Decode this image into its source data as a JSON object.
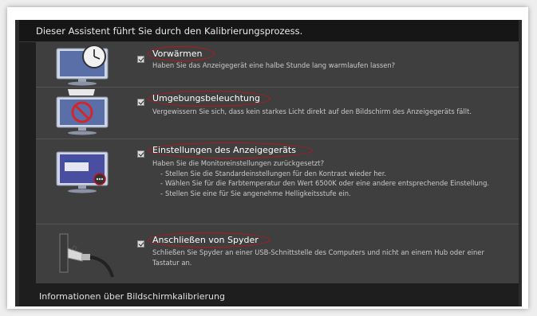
{
  "header": {
    "text": "Dieser Assistent führt Sie durch den Kalibrierungsprozess."
  },
  "steps": [
    {
      "title": "Vorwärmen",
      "checked": true,
      "icon": "monitor-clock-icon",
      "desc": "Haben Sie das Anzeigegerät eine halbe Stunde lang warmlaufen lassen?"
    },
    {
      "title": "Umgebungsbeleuchtung",
      "checked": true,
      "icon": "monitor-no-light-icon",
      "desc": "Vergewissern Sie sich, dass kein starkes Licht direkt auf den Bildschirm des Anzeigegeräts fällt."
    },
    {
      "title": "Einstellungen des Anzeigegeräts",
      "checked": true,
      "icon": "monitor-settings-icon",
      "desc": "Haben Sie die Monitoreinstellungen zurückgesetzt?",
      "bullets": [
        "Stellen Sie die Standardeinstellungen für den Kontrast wieder her.",
        "Wählen Sie für die Farbtemperatur den Wert 6500K oder eine andere entsprechende Einstellung.",
        "Stellen Sie eine für Sie angenehme Helligkeitsstufe ein."
      ]
    },
    {
      "title": "Anschließen von Spyder",
      "checked": true,
      "icon": "usb-plug-icon",
      "desc": "Schließen Sie Spyder an einer USB-Schnittstelle des Computers und nicht an einem Hub oder einer Tastatur an."
    }
  ],
  "footer": {
    "text": "Informationen über Bildschirmkalibrierung"
  },
  "colors": {
    "annotation": "#c0141c",
    "row_bg": "#3f3f3f",
    "window_bg": "#1e1e1e"
  }
}
